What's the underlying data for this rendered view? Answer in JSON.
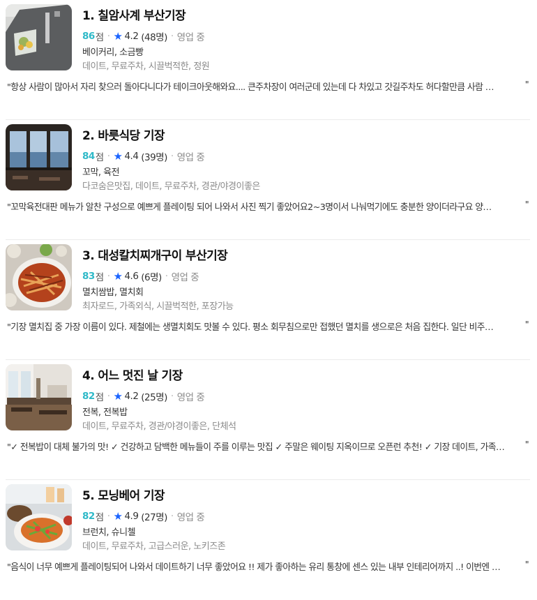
{
  "restaurants": [
    {
      "rank_name": "1. 칠암사계 부산기장",
      "score": "86",
      "score_unit": "점",
      "rating": "4.2",
      "reviews": "(48명)",
      "status": "영업 중",
      "categories": "베이커리, 소금빵",
      "tags": "데이트, 무료주차, 시끌벅적한, 정원",
      "quote": "항상 사람이 많아서 자리 찾으러 돌아다니다가 테이크아웃해와요.... 큰주차장이 여러군데 있는데 다 차있고 갓길주차도 허다할만큼 사람 …",
      "thumb_icon": "bakery-sign-photo"
    },
    {
      "rank_name": "2. 바릇식당 기장",
      "score": "84",
      "score_unit": "점",
      "rating": "4.4",
      "reviews": "(39명)",
      "status": "영업 중",
      "categories": "꼬막, 육전",
      "tags": "다코숨은맛집, 데이트, 무료주차, 경관/야경이좋은",
      "quote": "꼬막육전대판 메뉴가 알찬 구성으로 예쁘게 플레이팅 되어 나와서 사진 찍기 좋았어요2~3명이서 나눠먹기에도 충분한 양이더라구요 양…",
      "thumb_icon": "ocean-window-photo"
    },
    {
      "rank_name": "3. 대성칼치찌개구이 부산기장",
      "score": "83",
      "score_unit": "점",
      "rating": "4.6",
      "reviews": "(6명)",
      "status": "영업 중",
      "categories": "멸치쌈밥, 멸치회",
      "tags": "최자로드, 가족외식, 시끌벅적한, 포장가능",
      "quote": "기장 멸치집 중 가장 이름이 있다. 제철에는 생멸치회도 맛볼 수 있다. 평소 회무침으로만 접했던 멸치를 생으로은 처음 집한다. 일단 비주…",
      "thumb_icon": "anchovy-dish-photo"
    },
    {
      "rank_name": "4. 어느 멋진 날 기장",
      "score": "82",
      "score_unit": "점",
      "rating": "4.2",
      "reviews": "(25명)",
      "status": "영업 중",
      "categories": "전복, 전복밥",
      "tags": "데이트, 무료주차, 경관/야경이좋은, 단체석",
      "quote": "✓ 전복밥이 대체 불가의 맛! ✓ 건강하고 담백한 메뉴들이 주를 이루는 맛집 ✓ 주말은 웨이팅 지옥이므로 오픈런 추천! ✓ 기장 데이트, 가족…",
      "thumb_icon": "restaurant-interior-photo"
    },
    {
      "rank_name": "5. 모닝베어 기장",
      "score": "82",
      "score_unit": "점",
      "rating": "4.9",
      "reviews": "(27명)",
      "status": "영업 중",
      "categories": "브런치, 슈니첼",
      "tags": "데이트, 무료주차, 고급스러운, 노키즈존",
      "quote": "음식이 너무 예쁘게 플레이팅되어 나와서 데이트하기 너무 좋았어요 !! 제가 좋아하는 유리 통창에 센스 있는 내부 인테리어까지 ..! 이번엔 …",
      "thumb_icon": "brunch-plate-photo"
    }
  ],
  "separator": "·",
  "quote_open": "\"",
  "quote_close": "\"",
  "colors": {
    "score": "#2fb9c8",
    "star": "#1a64ff",
    "muted": "#8a8a8a"
  }
}
